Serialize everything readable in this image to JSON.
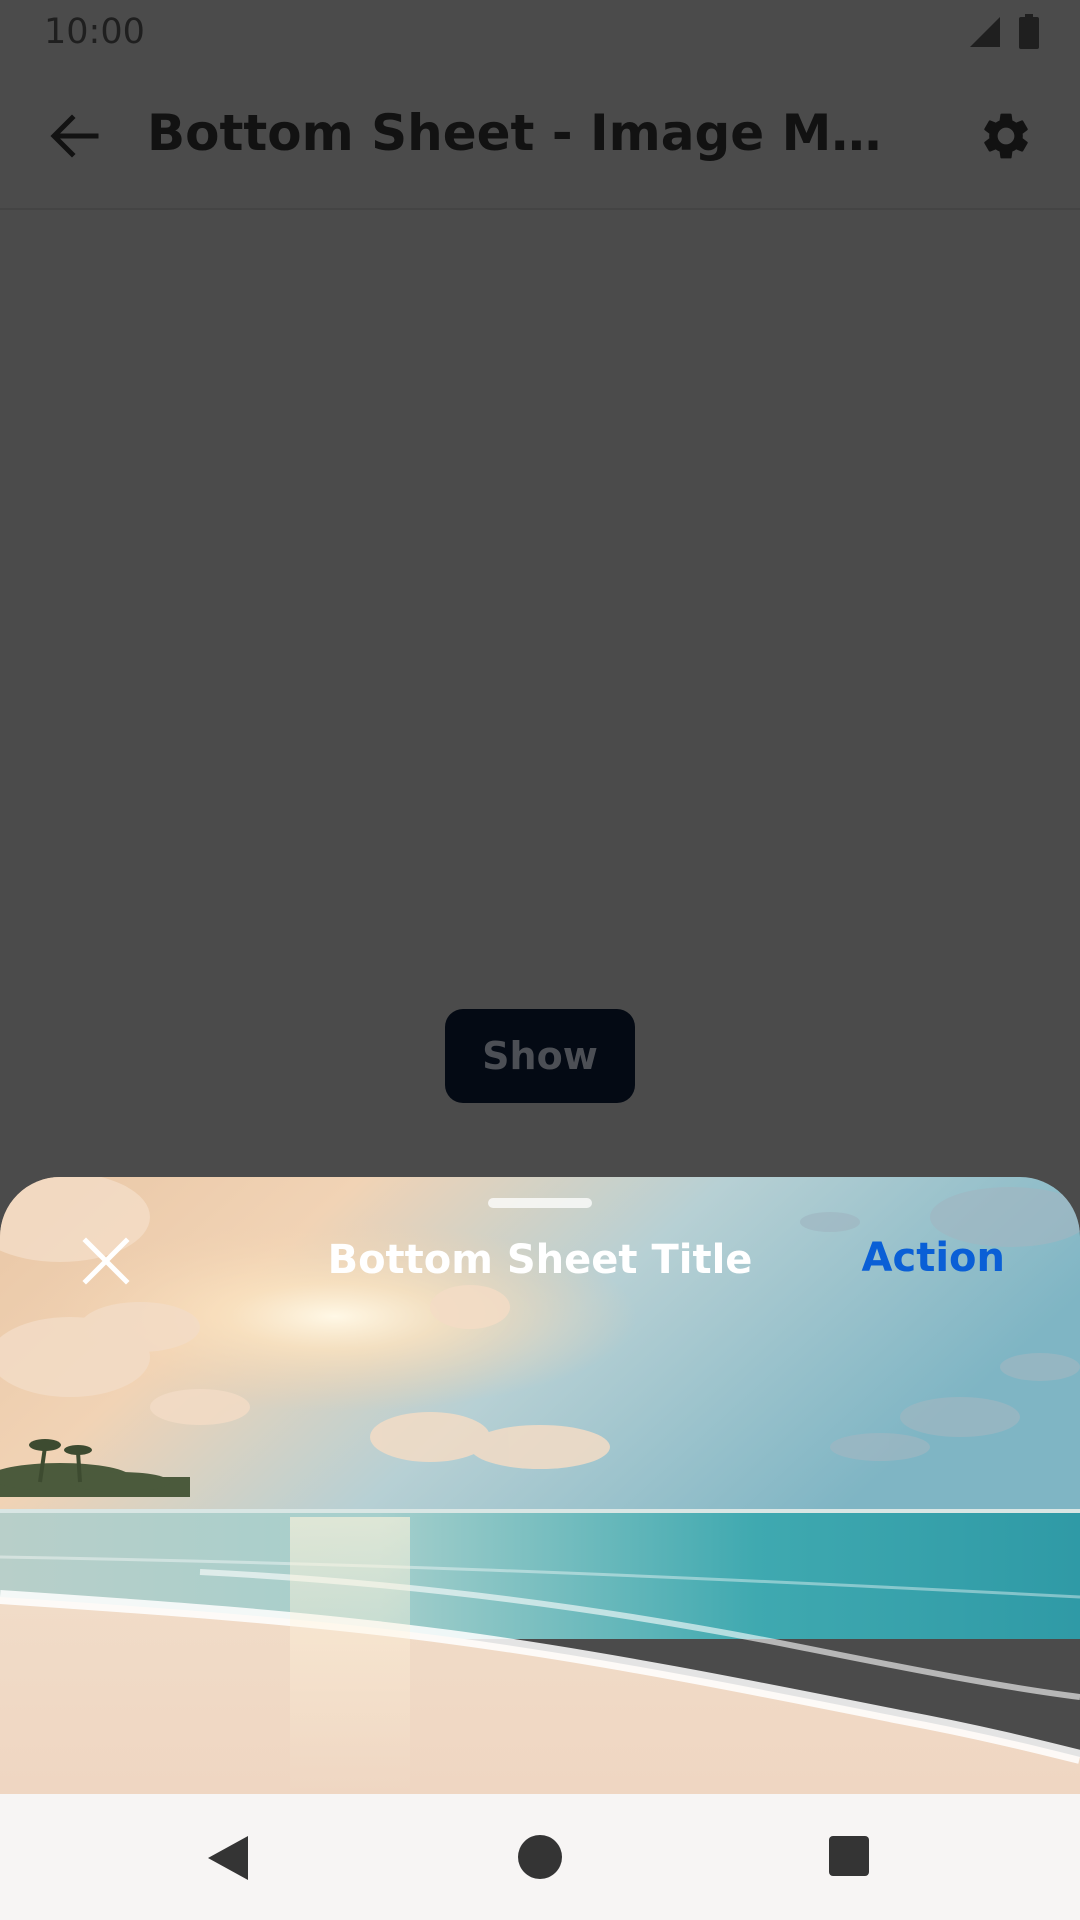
{
  "status_bar": {
    "time": "10:00",
    "icons": [
      "signal-icon",
      "battery-icon"
    ]
  },
  "app_bar": {
    "back_icon": "arrow-back-icon",
    "title": "Bottom Sheet - Image Modal s...",
    "settings_icon": "gear-icon"
  },
  "main": {
    "show_label": "Show"
  },
  "bottom_sheet": {
    "title": "Bottom Sheet Title",
    "action_label": "Action",
    "close_icon": "close-icon",
    "image": "beach-sunset-image"
  },
  "nav_bar": {
    "icons": [
      "nav-back-icon",
      "nav-home-icon",
      "nav-recents-icon"
    ]
  },
  "colors": {
    "scrim": "#4b4b4b",
    "show_button_bg": "#040a14",
    "action": "#0a5fd6",
    "nav_bar_bg": "#f7f5f4"
  }
}
